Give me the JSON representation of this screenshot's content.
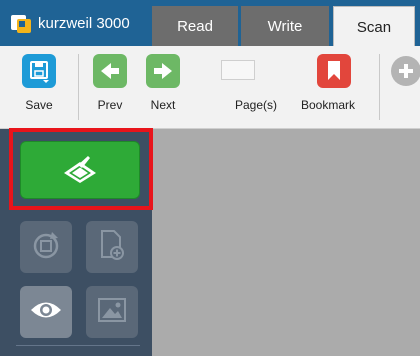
{
  "app": {
    "brand": "kurzweil 3000"
  },
  "tabs": [
    {
      "label": "Read"
    },
    {
      "label": "Write"
    },
    {
      "label": "Scan",
      "active": true
    }
  ],
  "toolbar": {
    "save_label": "Save",
    "prev_label": "Prev",
    "next_label": "Next",
    "pages_label": "Page(s)",
    "pages_value": "",
    "bookmark_label": "Bookmark"
  },
  "colors": {
    "tabbar": "#1f6395",
    "tab_inactive": "#6d6d6d",
    "scan_green": "#2eaa37",
    "highlight_red": "#e8141b",
    "bookmark_red": "#e2463c",
    "nav_green": "#6db865",
    "save_blue": "#1e9bd7"
  },
  "icons": {
    "scan": "scanner-icon",
    "rotate": "rotate-icon",
    "add_page": "add-page-icon",
    "view": "eye-icon",
    "image": "image-icon"
  }
}
